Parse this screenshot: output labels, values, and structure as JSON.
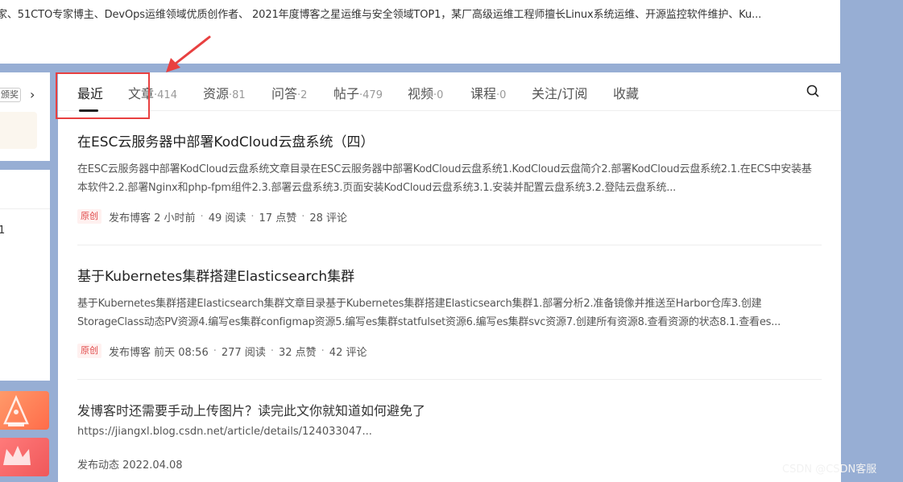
{
  "profile": {
    "bio": "家、51CTO专家博主、DevOps运维领域优质创作者、 2021年度博客之星运维与安全领域TOP1，某厂高级运维工程师擅长Linux系统运维、开源监控软件维护、Ku..."
  },
  "sidebar": {
    "badge_text": "颁奖",
    "chevron": "›",
    "number": "1"
  },
  "tabs": [
    {
      "label": "最近",
      "count": ""
    },
    {
      "label": "文章",
      "count": "·414"
    },
    {
      "label": "资源",
      "count": "·81"
    },
    {
      "label": "问答",
      "count": "·2"
    },
    {
      "label": "帖子",
      "count": "·479"
    },
    {
      "label": "视频",
      "count": "·0"
    },
    {
      "label": "课程",
      "count": "·0"
    },
    {
      "label": "关注/订阅",
      "count": ""
    },
    {
      "label": "收藏",
      "count": ""
    }
  ],
  "articles": [
    {
      "title": "在ESC云服务器中部署KodCloud云盘系统（四）",
      "summary": "在ESC云服务器中部署KodCloud云盘系统文章目录在ESC云服务器中部署KodCloud云盘系统1.KodCloud云盘简介2.部署KodCloud云盘系统2.1.在ECS中安装基本软件2.2.部署Nginx和php-fpm组件2.3.部署云盘系统3.页面安装KodCloud云盘系统3.1.安装并配置云盘系统3.2.登陆云盘系统...",
      "tag": "原创",
      "published": "发布博客 2 小时前",
      "reads": "49 阅读",
      "likes": "17 点赞",
      "comments": "28 评论"
    },
    {
      "title": "基于Kubernetes集群搭建Elasticsearch集群",
      "summary": "基于Kubernetes集群搭建Elasticsearch集群文章目录基于Kubernetes集群搭建Elasticsearch集群1.部署分析2.准备镜像并推送至Harbor仓库3.创建StorageClass动态PV资源4.编写es集群configmap资源5.编写es集群statfulset资源6.编写es集群svc资源7.创建所有资源8.查看资源的状态8.1.查看es...",
      "tag": "原创",
      "published": "发布博客 前天 08:56",
      "reads": "277 阅读",
      "likes": "32 点赞",
      "comments": "42 评论"
    }
  ],
  "dynamic": {
    "title": "发博客时还需要手动上传图片？读完此文你就知道如何避免了",
    "url": "https://jiangxl.blog.csdn.net/article/details/124033047...",
    "published": "发布动态 2022.04.08"
  },
  "meta_sep": "·",
  "watermark": "CSDN @CSDN客服",
  "icons": {
    "search": "search-icon",
    "arrow": "red-arrow-annotation"
  },
  "colors": {
    "background": "#97aed4",
    "annotation": "#e84040",
    "tag_original": "#e04a4a"
  }
}
